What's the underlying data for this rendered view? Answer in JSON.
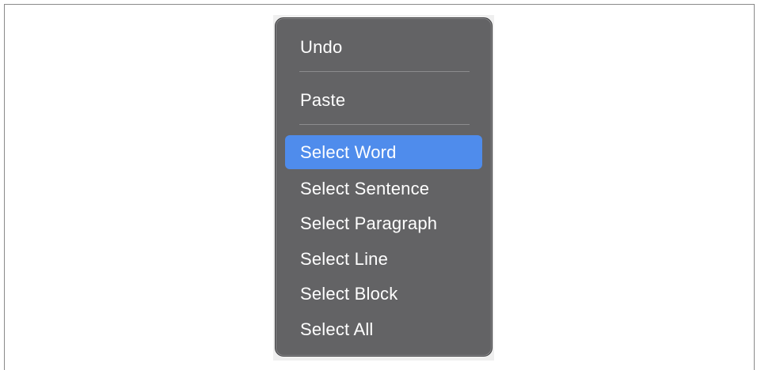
{
  "context_menu": {
    "undo_label": "Undo",
    "paste_label": "Paste",
    "select_word_label": "Select Word",
    "select_sentence_label": "Select Sentence",
    "select_paragraph_label": "Select Paragraph",
    "select_line_label": "Select Line",
    "select_block_label": "Select Block",
    "select_all_label": "Select All",
    "highlighted_item": "Select Word"
  },
  "colors": {
    "menu_background": "#636365",
    "highlight": "#4f8cec",
    "text": "#ffffff",
    "separator": "#8c8c8e"
  }
}
